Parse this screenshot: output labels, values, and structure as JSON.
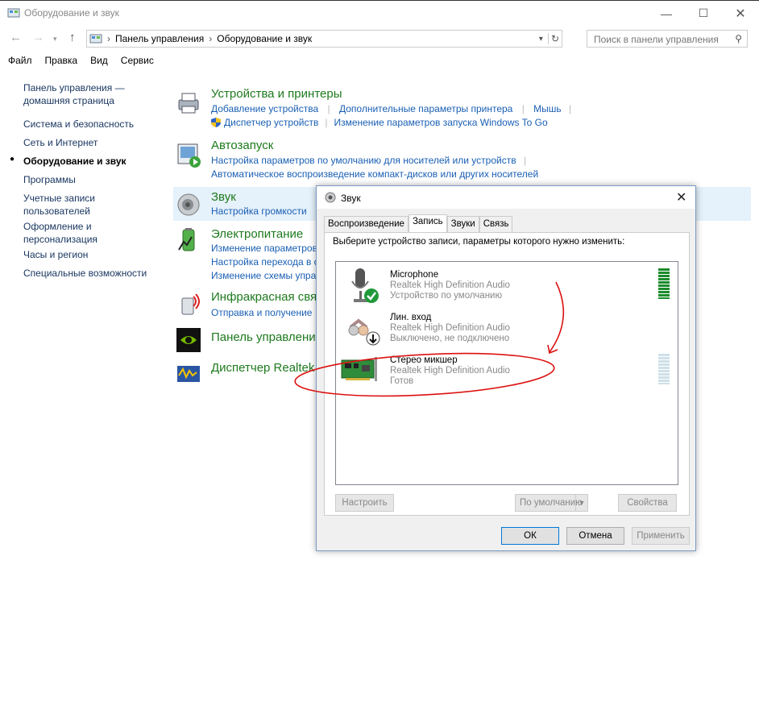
{
  "window": {
    "title": "Оборудование и звук"
  },
  "nav": {
    "breadcrumb": [
      "Панель управления",
      "Оборудование и звук"
    ],
    "search_placeholder": "Поиск в панели управления"
  },
  "menu": [
    "Файл",
    "Правка",
    "Вид",
    "Сервис"
  ],
  "sidebar": {
    "home": [
      "Панель управления —",
      "домашняя страница"
    ],
    "items": [
      "Система и безопасность",
      "Сеть и Интернет",
      "Оборудование и звук",
      "Программы",
      "Учетные записи",
      "пользователей",
      "Оформление и",
      "персонализация",
      "Часы и регион",
      "Специальные возможности"
    ]
  },
  "categories": {
    "devices": {
      "title": "Устройства и принтеры",
      "links": [
        "Добавление устройства",
        "Дополнительные параметры принтера",
        "Мышь",
        "Диспетчер устройств",
        "Изменение параметров запуска Windows To Go"
      ]
    },
    "autoplay": {
      "title": "Автозапуск",
      "links": [
        "Настройка параметров по умолчанию для носителей или устройств",
        "Автоматическое воспроизведение компакт-дисков или других носителей"
      ]
    },
    "sound": {
      "title": "Звук",
      "links": [
        "Настройка громкости"
      ]
    },
    "power": {
      "title": "Электропитание",
      "links": [
        "Изменение параметров",
        "Настройка перехода в с",
        "Изменение схемы упра"
      ]
    },
    "infrared": {
      "title": "Инфракрасная свя",
      "links": [
        "Отправка и получение"
      ]
    },
    "nvidia": {
      "title": "Панель управлени"
    },
    "realtek": {
      "title": "Диспетчер Realtek"
    }
  },
  "dialog": {
    "title": "Звук",
    "tabs": [
      "Воспроизведение",
      "Запись",
      "Звуки",
      "Связь"
    ],
    "active_tab": "Запись",
    "instruction": "Выберите устройство записи, параметры которого нужно изменить:",
    "devices": [
      {
        "name": "Microphone",
        "driver": "Realtek High Definition Audio",
        "status": "Устройство по умолчанию"
      },
      {
        "name": "Лин. вход",
        "driver": "Realtek High Definition Audio",
        "status": "Выключено, не подключено"
      },
      {
        "name": "Стерео микшер",
        "driver": "Realtek High Definition Audio",
        "status": "Готов"
      }
    ],
    "buttons": {
      "configure": "Настроить",
      "default": "По умолчанию",
      "properties": "Свойства",
      "ok": "ОК",
      "cancel": "Отмена",
      "apply": "Применить"
    }
  },
  "colors": {
    "accent_green": "#1e7a1e",
    "link_blue": "#1a5fb4",
    "annotation_red": "#d11"
  }
}
